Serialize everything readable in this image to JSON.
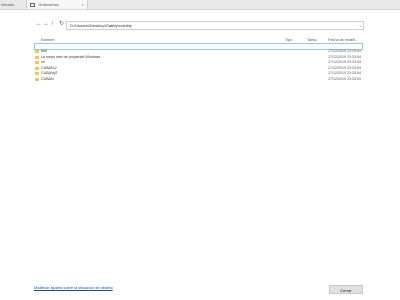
{
  "tabs": [
    {
      "label": "ntenido",
      "icon": "",
      "active": false
    },
    {
      "label": "Ordenamos",
      "icon": "page-icon",
      "active": true
    }
  ],
  "tab_close": "×",
  "nav": {
    "back": "←",
    "forward": "→",
    "up": "↑",
    "refresh": "↻"
  },
  "address": {
    "value": "D:\\Usuario\\Desktop\\Gatbly\\sxshbly",
    "dropdown": "⌄"
  },
  "columns": {
    "name": "Nombre",
    "type": "Tipo",
    "size": "Tama..",
    "date": "Fecha de modifi..."
  },
  "rows": [
    {
      "name": "test",
      "date": "17/12/2019 23:33:54"
    },
    {
      "name": "La mejor web de propiedad Windows",
      "date": "17/12/2019 23:33:54"
    },
    {
      "name": "xn",
      "date": "17/12/2019 23:33:54"
    },
    {
      "name": "CUBAN-2",
      "date": "17/12/2019 23:33:54"
    },
    {
      "name": "CUBANy2",
      "date": "17/12/2019 23:33:54"
    },
    {
      "name": "CUBAN",
      "date": "17/12/2019 23:33:54"
    }
  ],
  "footer": {
    "link": "Modificar ajustes sobre la ubicación de destino",
    "close": "Cerrar"
  }
}
